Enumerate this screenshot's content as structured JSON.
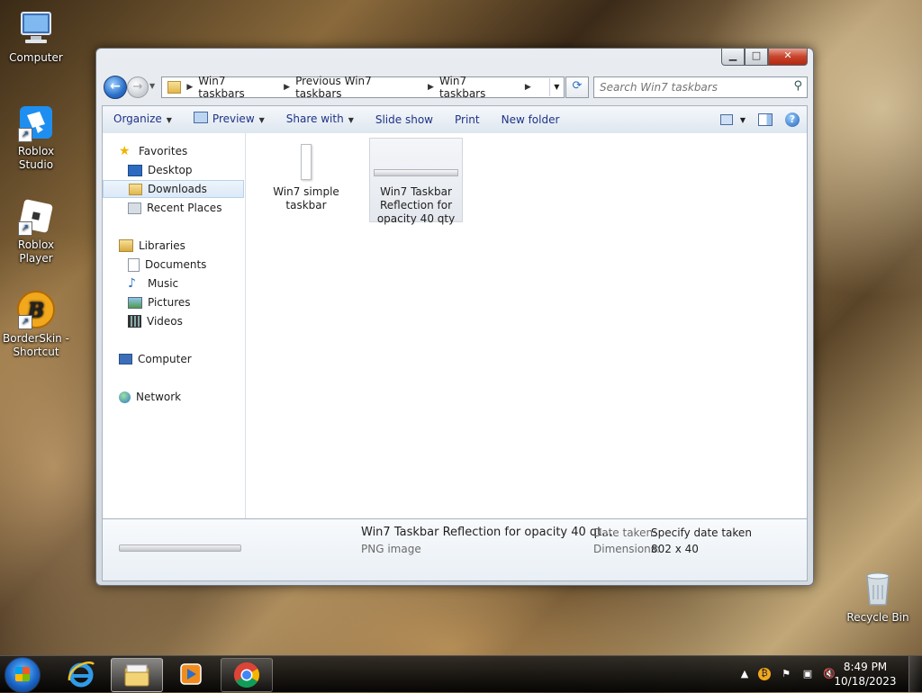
{
  "desktop": {
    "icons": [
      {
        "label": "Computer",
        "icon": "computer-icon"
      },
      {
        "label": "Roblox Studio",
        "icon": "roblox-studio-icon"
      },
      {
        "label": "Roblox Player",
        "icon": "roblox-player-icon"
      },
      {
        "label": "BorderSkin - Shortcut",
        "icon": "borderskin-icon"
      },
      {
        "label": "Recycle Bin",
        "icon": "recycle-bin-icon"
      }
    ]
  },
  "window": {
    "breadcrumbs": [
      "Win7 taskbars",
      "Previous Win7 taskbars",
      "Win7 taskbars"
    ],
    "search_placeholder": "Search Win7 taskbars",
    "toolbar": {
      "organize": "Organize",
      "preview": "Preview",
      "share_with": "Share with",
      "slide_show": "Slide show",
      "print": "Print",
      "new_folder": "New folder"
    },
    "nav": {
      "favorites": "Favorites",
      "desktop": "Desktop",
      "downloads": "Downloads",
      "recent_places": "Recent Places",
      "libraries": "Libraries",
      "documents": "Documents",
      "music": "Music",
      "pictures": "Pictures",
      "videos": "Videos",
      "computer": "Computer",
      "network": "Network"
    },
    "files": [
      {
        "name": "Win7 simple taskbar"
      },
      {
        "name": "Win7 Taskbar Reflection for opacity 40 qty"
      }
    ],
    "details": {
      "name": "Win7 Taskbar Reflection for opacity 40 qt...",
      "type": "PNG image",
      "date_label": "Date taken:",
      "date_value": "Specify date taken",
      "dim_label": "Dimensions:",
      "dim_value": "802 x 40"
    }
  },
  "taskbar": {
    "time": "8:49 PM",
    "date": "10/18/2023"
  }
}
